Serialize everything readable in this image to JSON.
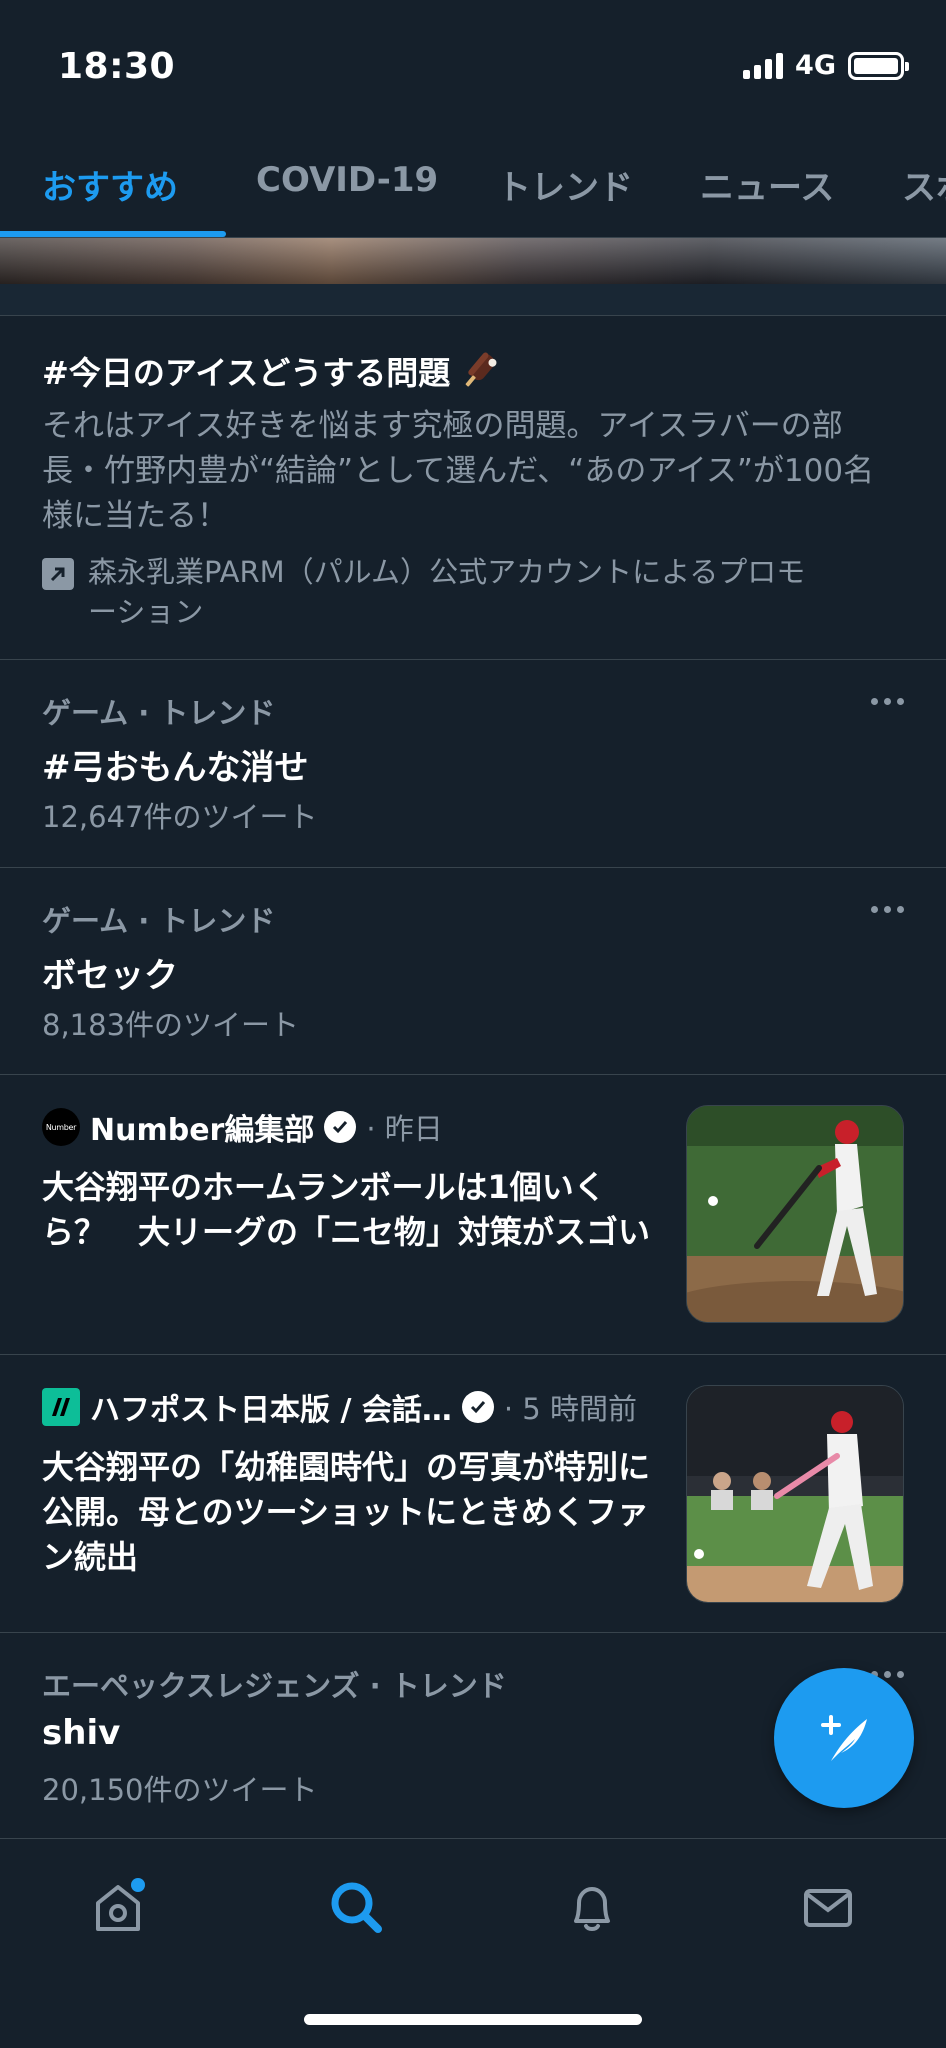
{
  "status_bar": {
    "time": "18:30",
    "network": "4G"
  },
  "tabs": [
    {
      "label": "おすすめ",
      "active": true
    },
    {
      "label": "COVID-19",
      "active": false
    },
    {
      "label": "トレンド",
      "active": false
    },
    {
      "label": "ニュース",
      "active": false
    },
    {
      "label": "スポ",
      "active": false
    }
  ],
  "promo": {
    "title": "#今日のアイスどうする問題",
    "description": "それはアイス好きを悩ます究極の問題。アイスラバーの部長・竹野内豊が“結論”として選んだ、“あのアイス”が100名様に当たる！",
    "promoted_by": "森永乳業PARM（パルム）公式アカウントによるプロモーション"
  },
  "trends": [
    {
      "meta": "ゲーム · トレンド",
      "title": "#弓おもんな消せ",
      "count": "12,647件のツイート"
    },
    {
      "meta": "ゲーム · トレンド",
      "title": "ボセック",
      "count": "8,183件のツイート"
    },
    {
      "meta": "エーペックスレジェンズ · トレンド",
      "title": "shiv",
      "count": "20,150件のツイート"
    }
  ],
  "news": [
    {
      "logo_text": "Number",
      "source": "Number編集部",
      "time": "· 昨日",
      "headline": "大谷翔平のホームランボールは1個いくら？　大リーグの「ニセ物」対策がスゴい"
    },
    {
      "logo_text": "",
      "source": "ハフポスト日本版 / 会話…",
      "time": "· 5 時間前",
      "headline": "大谷翔平の「幼稚園時代」の写真が特別に公開。母とのツーショットにときめくファン続出"
    }
  ],
  "colors": {
    "accent": "#1d9bf0",
    "background": "#15202b",
    "secondary_text": "#8b98a5",
    "divider": "#38444d"
  },
  "icons": {
    "nav": [
      "home-icon",
      "search-icon",
      "bell-icon",
      "mail-icon"
    ],
    "fab": "compose-icon"
  }
}
